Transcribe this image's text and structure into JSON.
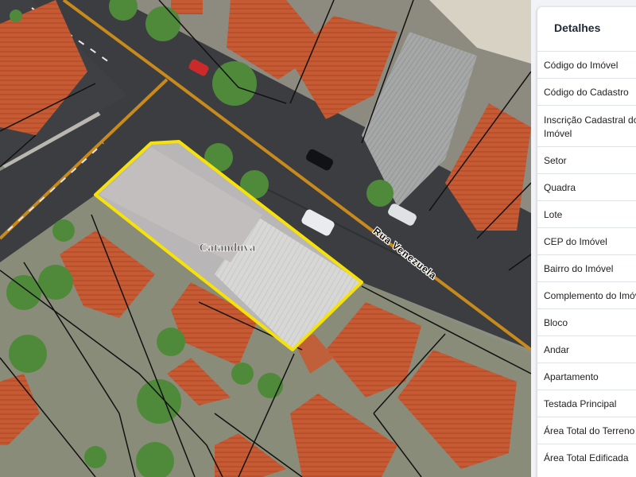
{
  "map": {
    "parcel_label": "Catanduva",
    "street_label": "Rua Venezuela",
    "colors": {
      "selection": "#f6e10a",
      "street": "#3a3c40",
      "centerline": "#c98a1c",
      "roof": "#c65a32",
      "tree": "#4d8a3a"
    }
  },
  "panel": {
    "title": "Detalhes",
    "rows": [
      "Código do Imóvel",
      "Código do Cadastro",
      "Inscrição Cadastral do Imóvel",
      "Setor",
      "Quadra",
      "Lote",
      "CEP do Imóvel",
      "Bairro do Imóvel",
      "Complemento do Imóvel",
      "Bloco",
      "Andar",
      "Apartamento",
      "Testada Principal",
      "Área Total do Terreno",
      "Área Total Edificada"
    ]
  }
}
